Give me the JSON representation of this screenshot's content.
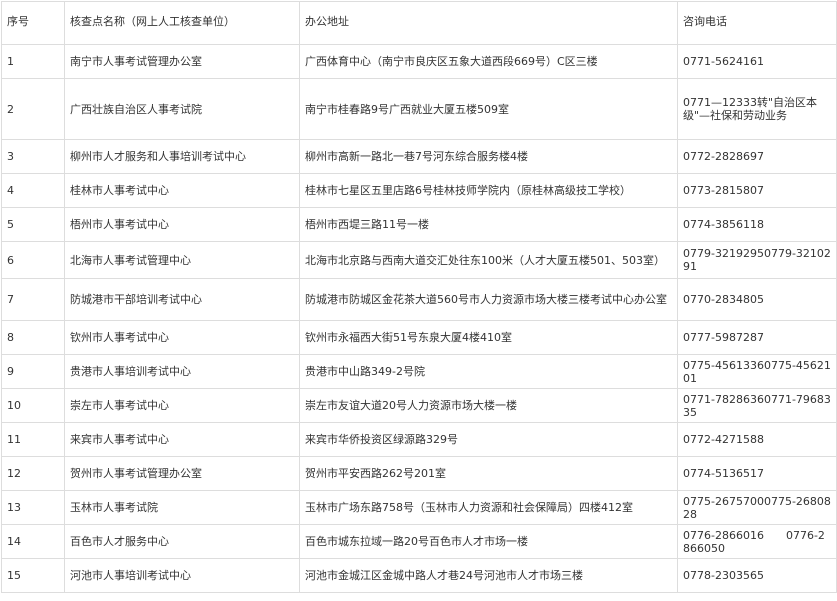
{
  "table": {
    "headers": [
      "序号",
      "核查点名称（网上人工核查单位）",
      "办公地址",
      "咨询电话"
    ],
    "rows": [
      [
        "1",
        "南宁市人事考试管理办公室",
        "广西体育中心（南宁市良庆区五象大道西段669号）C区三楼",
        "0771-5624161"
      ],
      [
        "2",
        "广西壮族自治区人事考试院",
        "南宁市桂春路9号广西就业大厦五楼509室",
        "0771—12333转\"自治区本级\"—社保和劳动业务"
      ],
      [
        "3",
        "柳州市人才服务和人事培训考试中心",
        "柳州市高新一路北一巷7号河东综合服务楼4楼",
        "0772-2828697"
      ],
      [
        "4",
        "桂林市人事考试中心",
        "桂林市七星区五里店路6号桂林技师学院内（原桂林高级技工学校）",
        "0773-2815807"
      ],
      [
        "5",
        "梧州市人事考试中心",
        "梧州市西堤三路11号一楼",
        "0774-3856118"
      ],
      [
        "6",
        "北海市人事考试管理中心",
        "北海市北京路与西南大道交汇处往东100米（人才大厦五楼501、503室）",
        "0779-32192950779-3210291"
      ],
      [
        "7",
        "防城港市干部培训考试中心",
        "防城港市防城区金花茶大道560号市人力资源市场大楼三楼考试中心办公室",
        "0770-2834805"
      ],
      [
        "8",
        "钦州市人事考试中心",
        "钦州市永福西大街51号东泉大厦4楼410室",
        "0777-5987287"
      ],
      [
        "9",
        "贵港市人事培训考试中心",
        "贵港市中山路349-2号院",
        "0775-45613360775-4562101"
      ],
      [
        "10",
        "崇左市人事考试中心",
        "崇左市友谊大道20号人力资源市场大楼一楼",
        "0771-78286360771-7968335"
      ],
      [
        "11",
        "来宾市人事考试中心",
        "来宾市华侨投资区绿源路329号",
        "0772-4271588"
      ],
      [
        "12",
        "贺州市人事考试管理办公室",
        "贺州市平安西路262号201室",
        "0774-5136517"
      ],
      [
        "13",
        "玉林市人事考试院",
        "玉林市广场东路758号（玉林市人力资源和社会保障局）四楼412室",
        "0775-26757000775-2680828"
      ],
      [
        "14",
        "百色市人才服务中心",
        "百色市城东拉域一路20号百色市人才市场一楼",
        "0776-2866016　　0776-2866050"
      ],
      [
        "15",
        "河池市人事培训考试中心",
        "河池市金城江区金城中路人才巷24号河池市人才市场三楼",
        "0778-2303565"
      ]
    ]
  }
}
